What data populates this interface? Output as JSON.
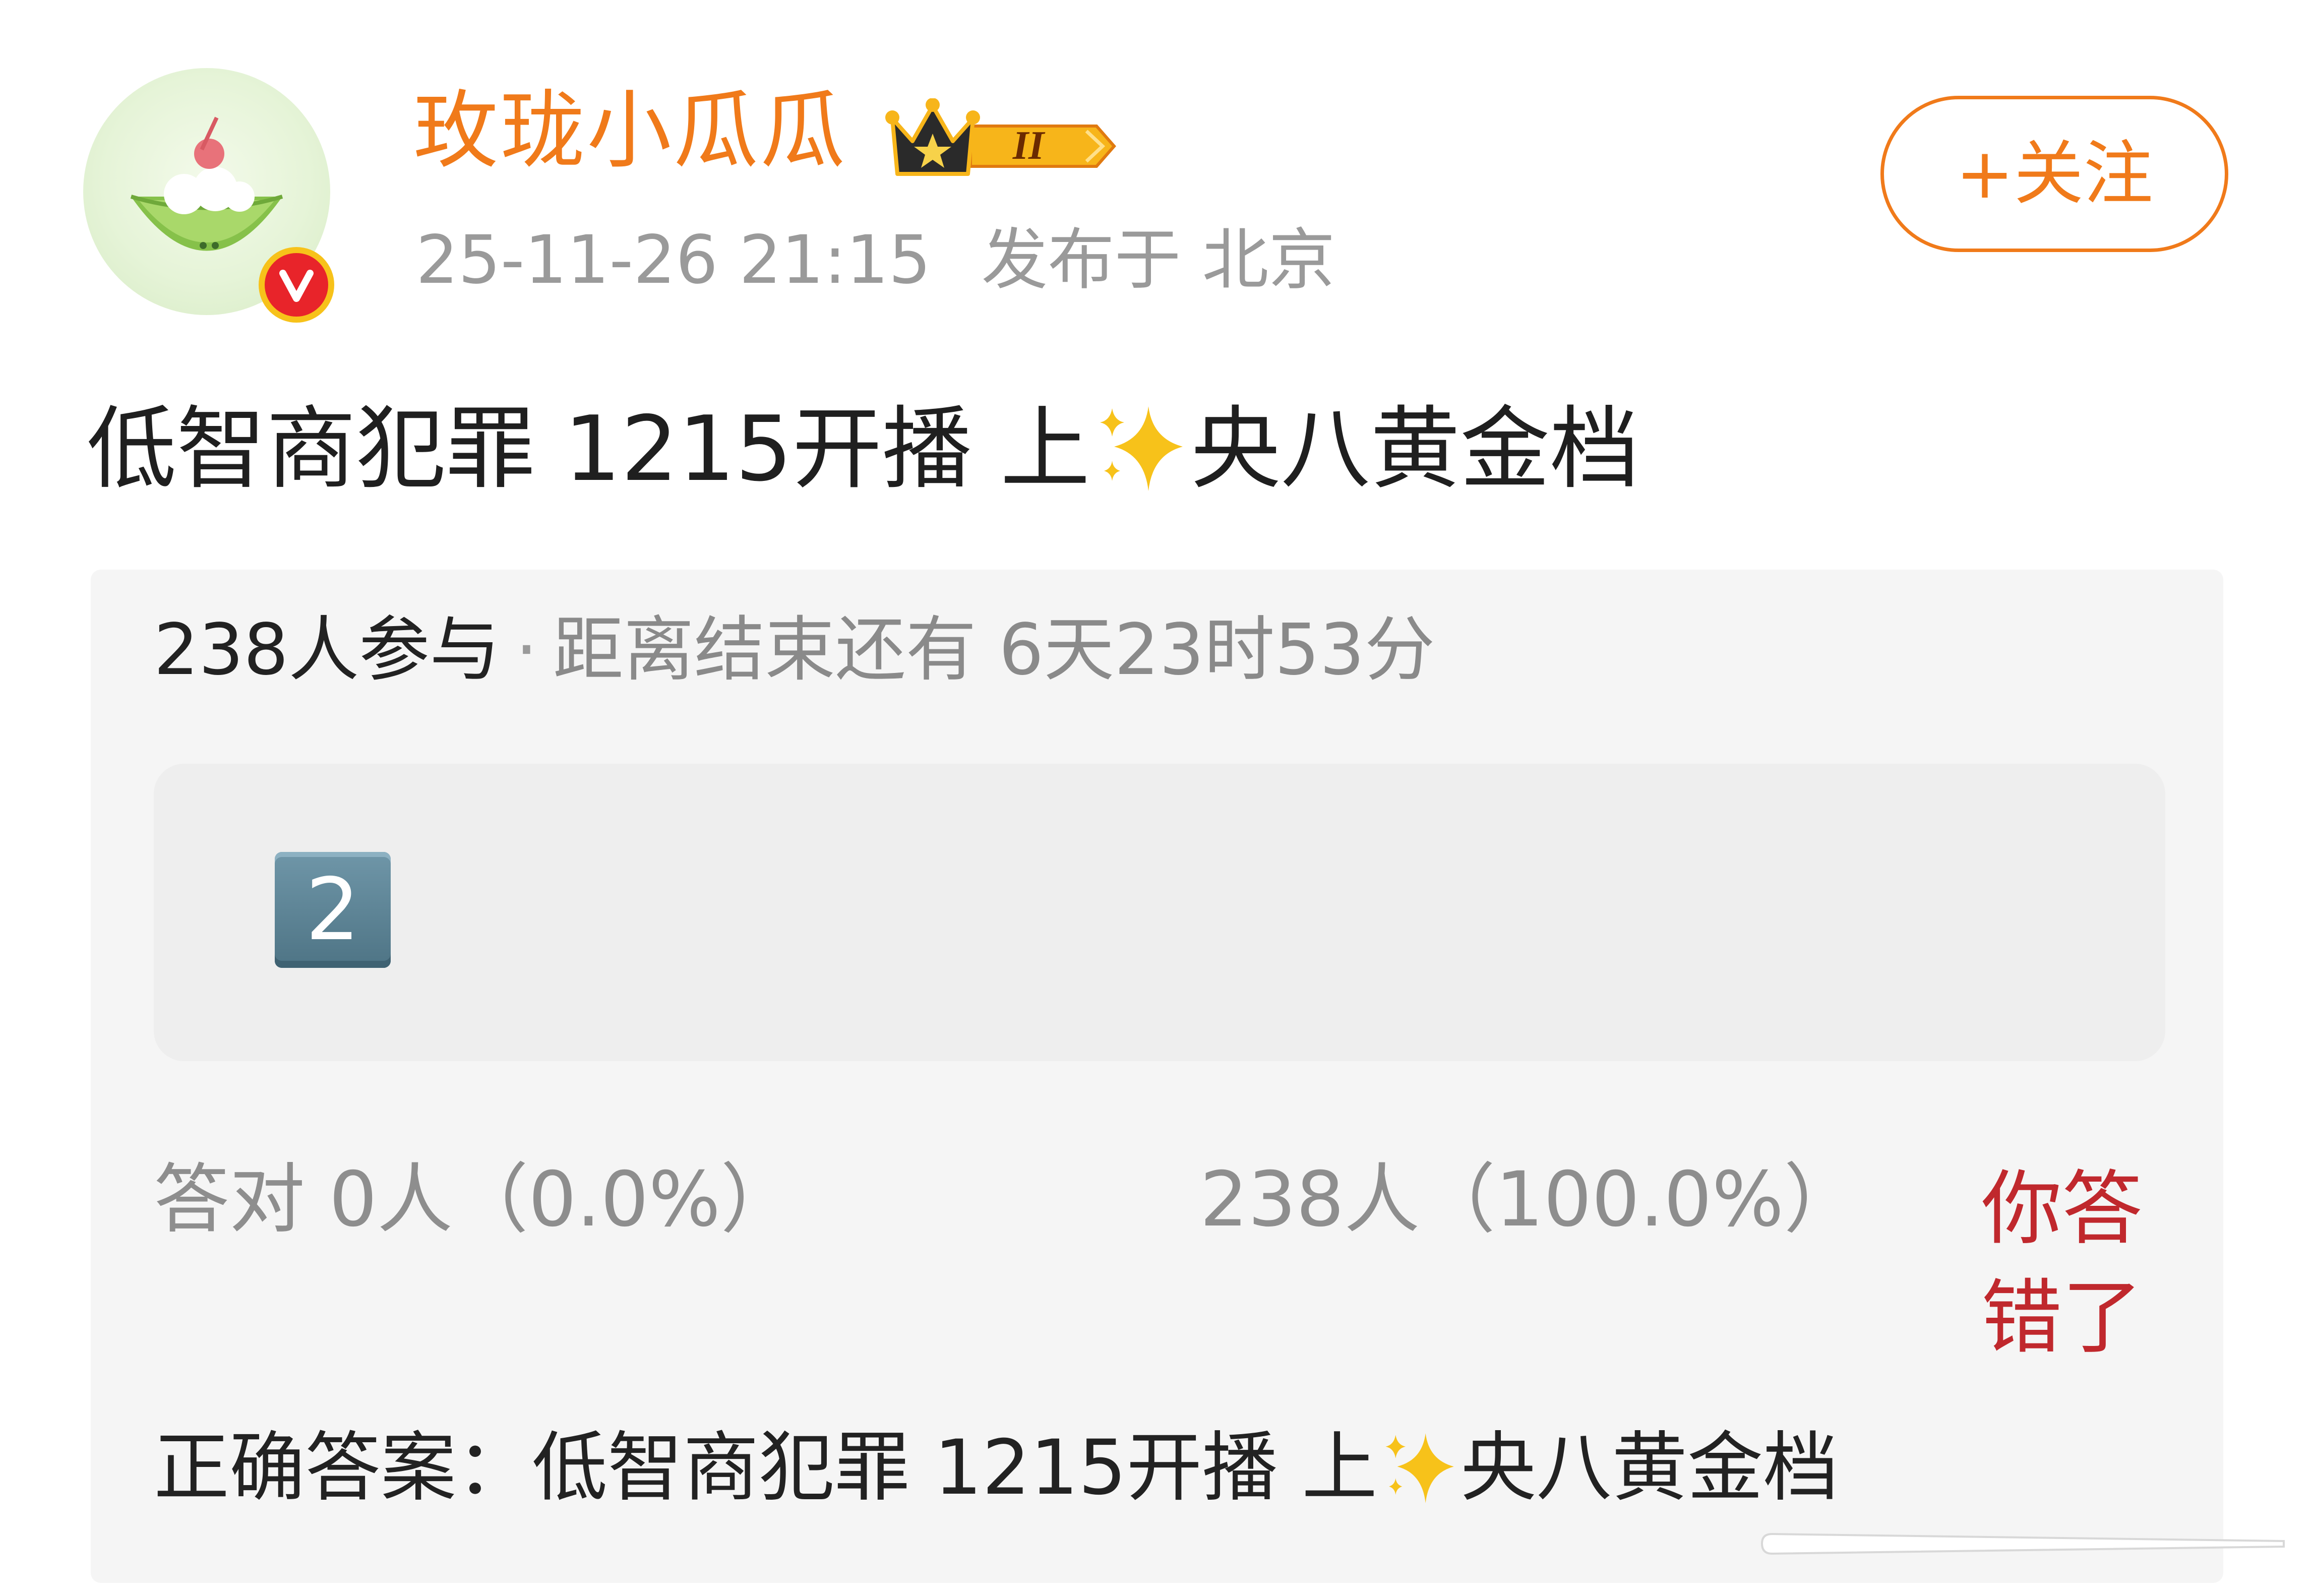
{
  "user": {
    "name": "玫珑小瓜瓜",
    "level_badge": "II",
    "post_time": "25-11-26 21:15",
    "location": "发布于 北京"
  },
  "follow_button": {
    "label": "+关注"
  },
  "post": {
    "text_before": "低智商犯罪 1215开播 上",
    "text_after": "央八黄金档"
  },
  "quiz": {
    "participants": "238人参与",
    "separator": "·",
    "remaining": "距离结束还有 6天23时53分",
    "option_label": "2",
    "correct_result": "答对  0人（0.0%）",
    "answered_result": "238人（100.0%）",
    "wrong_note": "你答错了",
    "answer_before": "正确答案：低智商犯罪 1215开播 上",
    "answer_after": "央八黄金档"
  },
  "colors": {
    "accent": "#f07a1a",
    "wrong": "#c0282d",
    "card_bg": "#f5f5f5"
  }
}
